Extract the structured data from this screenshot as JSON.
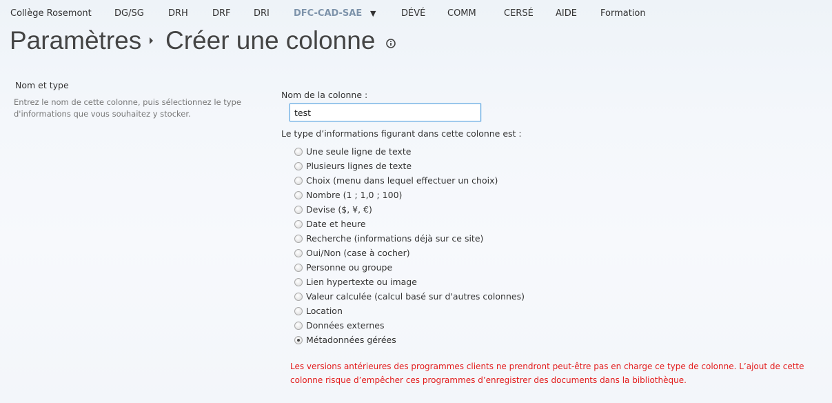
{
  "nav": {
    "items": [
      "Collège Rosemont",
      "DG/SG",
      "DRH",
      "DRF",
      "DRI",
      "DFC-CAD-SAE",
      "DÉVÉ",
      "COMM",
      "CERSÉ",
      "AIDE",
      "Formation"
    ],
    "active": "DFC-CAD-SAE",
    "caret_icon": "caret-down-icon"
  },
  "breadcrumb": {
    "parent": "Paramètres",
    "current": "Créer une colonne",
    "info_icon": "info-icon"
  },
  "section": {
    "title": "Nom et type",
    "description": "Entrez le nom de cette colonne, puis sélectionnez le type d'informations que vous souhaitez y stocker."
  },
  "form": {
    "name_label": "Nom de la colonne :",
    "name_value": "test",
    "type_label": "Le type d’informations figurant dans cette colonne est :",
    "types": [
      "Une seule ligne de texte",
      "Plusieurs lignes de texte",
      "Choix (menu dans lequel effectuer un choix)",
      "Nombre (1 ; 1,0 ; 100)",
      "Devise ($, ¥, €)",
      "Date et heure",
      "Recherche (informations déjà sur ce site)",
      "Oui/Non (case à cocher)",
      "Personne ou groupe",
      "Lien hypertexte ou image",
      "Valeur calculée (calcul basé sur d'autres colonnes)",
      "Location",
      "Données externes",
      "Métadonnées gérées"
    ],
    "selected_type": "Métadonnées gérées",
    "warning": "Les versions antérieures des programmes clients ne prendront peut-être pas en charge ce type de colonne. L’ajout de cette colonne risque d’empêcher ces programmes d’enregistrer des documents dans la bibliothèque."
  },
  "colors": {
    "active_nav": "#7d93aa",
    "warning": "#e31b1b",
    "input_border": "#5aa4e0"
  }
}
